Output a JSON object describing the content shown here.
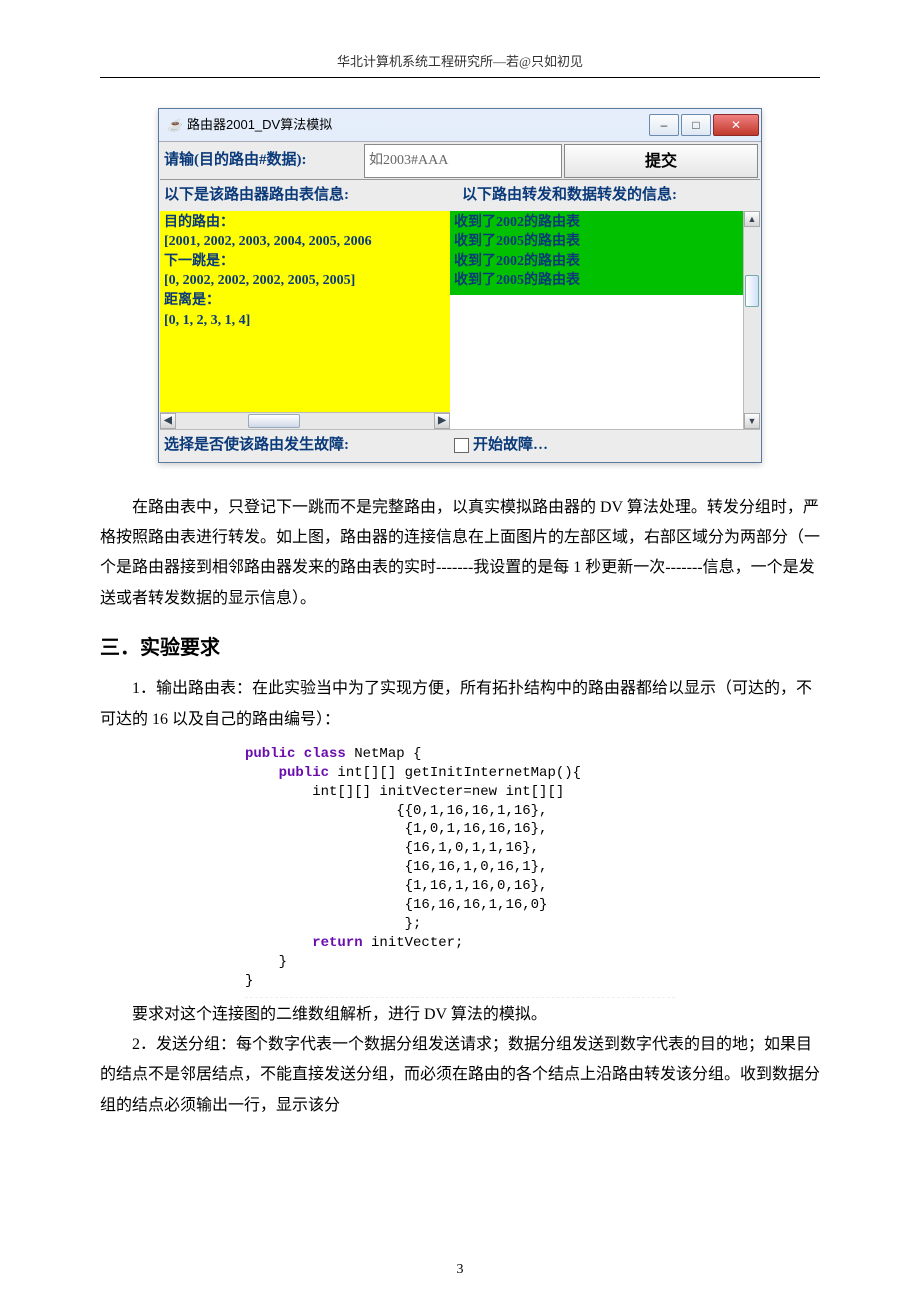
{
  "doc": {
    "header": "华北计算机系统工程研究所—若@只如初见",
    "page_number": "3"
  },
  "win": {
    "title": "路由器2001_DV算法模拟",
    "input_label": "请输(目的路由#数据):",
    "input_placeholder": "如2003#AAA",
    "submit": "提交",
    "left_section_label": "以下是该路由器路由表信息:",
    "right_section_label": "以下路由转发和数据转发的信息:",
    "route_table": {
      "dest_label": "目的路由：",
      "dest_values": "[2001, 2002, 2003, 2004, 2005, 2006",
      "next_label": "下一跳是：",
      "next_values": "[0, 2002, 2002, 2002, 2005, 2005]",
      "dist_label": "距离是：",
      "dist_values": "[0, 1, 2, 3, 1, 4]"
    },
    "log": {
      "l1": "收到了2002的路由表",
      "l2": "收到了2005的路由表",
      "l3": "收到了2002的路由表",
      "l4": "收到了2005的路由表"
    },
    "fault_label": "选择是否使该路由发生故障:",
    "fault_check_label": "开始故障…"
  },
  "body": {
    "p1": "在路由表中，只登记下一跳而不是完整路由，以真实模拟路由器的 DV 算法处理。转发分组时，严格按照路由表进行转发。如上图，路由器的连接信息在上面图片的左部区域，右部区域分为两部分（一个是路由器接到相邻路由器发来的路由表的实时-------我设置的是每 1 秒更新一次-------信息，一个是发送或者转发数据的显示信息）。",
    "h2": "三．实验要求",
    "p2": "1．输出路由表：在此实验当中为了实现方便，所有拓扑结构中的路由器都给以显示（可达的，不可达的 16 以及自己的路由编号）：",
    "p3": "要求对这个连接图的二维数组解析，进行 DV 算法的模拟。",
    "p4": "2．发送分组：每个数字代表一个数据分组发送请求；数据分组发送到数字代表的目的地；如果目的结点不是邻居结点，不能直接发送分组，而必须在路由的各个结点上沿路由转发该分组。收到数据分组的结点必须输出一行，显示该分"
  },
  "code": {
    "l1a": "public class",
    "l1b": " NetMap {",
    "l2a": "    public",
    "l2b": " int[][] getInitInternetMap(){",
    "l3": "        int[][] initVecter=new int[][]",
    "l4": "                  {{0,1,16,16,1,16},",
    "l5": "                   {1,0,1,16,16,16},",
    "l6": "                   {16,1,0,1,1,16},",
    "l7": "                   {16,16,1,0,16,1},",
    "l8": "                   {1,16,1,16,0,16},",
    "l9": "                   {16,16,16,1,16,0}",
    "l10": "                   };",
    "l11a": "        return",
    "l11b": " initVecter;",
    "l12": "    }",
    "l13": "}"
  }
}
